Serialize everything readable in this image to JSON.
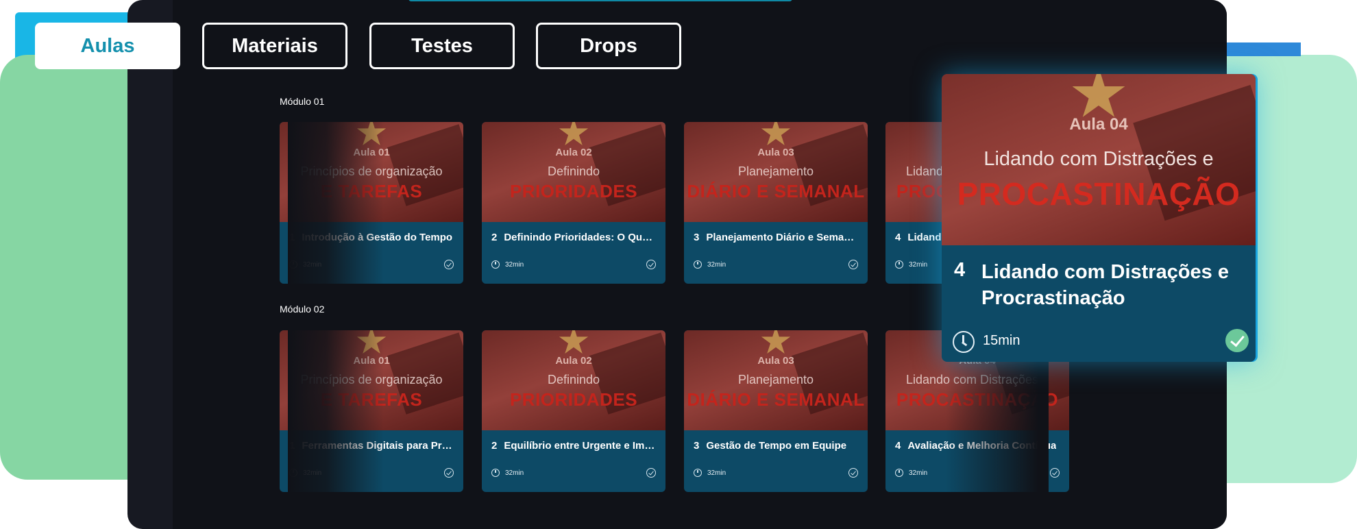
{
  "tabs": [
    {
      "label": "Aulas",
      "active": true
    },
    {
      "label": "Materiais"
    },
    {
      "label": "Testes"
    },
    {
      "label": "Drops"
    }
  ],
  "modules": [
    {
      "title": "Módulo 01",
      "lessons": [
        {
          "num": "1",
          "title": "Introdução à Gestão do Tempo",
          "duration": "32min",
          "thumb_aula": "Aula 01",
          "thumb_sub": "Princípios de organização",
          "thumb_big": "E TAREFAS"
        },
        {
          "num": "2",
          "title": "Definindo Prioridades: O Que Importa",
          "duration": "32min",
          "thumb_aula": "Aula 02",
          "thumb_sub": "Definindo",
          "thumb_big": "PRIORIDADES"
        },
        {
          "num": "3",
          "title": "Planejamento Diário e Semanal",
          "duration": "32min",
          "thumb_aula": "Aula 03",
          "thumb_sub": "Planejamento",
          "thumb_big": "DIÁRIO E SEMANAL"
        },
        {
          "num": "4",
          "title": "Lidando com Distrações e Procrastinação",
          "duration": "32min",
          "thumb_aula": "Aula 04",
          "thumb_sub": "Lidando com Distrações e",
          "thumb_big": "PROCASTINAÇÃO"
        }
      ]
    },
    {
      "title": "Módulo 02",
      "lessons": [
        {
          "num": "1",
          "title": "Ferramentas Digitais para Produtividade",
          "duration": "32min",
          "thumb_aula": "Aula 01",
          "thumb_sub": "Princípios de organização",
          "thumb_big": "E TAREFAS"
        },
        {
          "num": "2",
          "title": "Equilíbrio entre Urgente e Importante",
          "duration": "32min",
          "thumb_aula": "Aula 02",
          "thumb_sub": "Definindo",
          "thumb_big": "PRIORIDADES"
        },
        {
          "num": "3",
          "title": "Gestão de Tempo em Equipe",
          "duration": "32min",
          "thumb_aula": "Aula 03",
          "thumb_sub": "Planejamento",
          "thumb_big": "DIÁRIO E SEMANAL"
        },
        {
          "num": "4",
          "title": "Avaliação e Melhoria Contínua",
          "duration": "32min",
          "thumb_aula": "Aula 04",
          "thumb_sub": "Lidando com Distrações e",
          "thumb_big": "PROCASTINAÇÃO"
        }
      ]
    }
  ],
  "featured": {
    "num": "4",
    "title": "Lidando com Distrações e Procrastinação",
    "duration": "15min",
    "thumb_aula": "Aula 04",
    "thumb_sub": "Lidando com Distrações e",
    "thumb_big": "PROCASTINAÇÃO"
  },
  "icons": {
    "prev": "chevron-left-icon",
    "next": "chevron-right-icon",
    "duration": "clock-icon",
    "completed": "check-circle-icon"
  },
  "colors": {
    "accent": "#1490ad",
    "card": "#0d4a66",
    "title_red": "#c4241c",
    "check_green": "#6cc89a"
  }
}
